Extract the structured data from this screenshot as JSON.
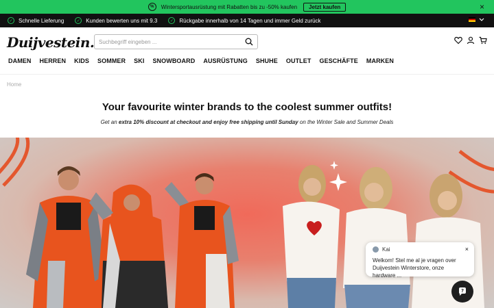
{
  "promo": {
    "text": "Wintersportausrüstung mit Rabatten bis zu -50% kaufen",
    "cta": "Jetzt kaufen",
    "icon": "percent-badge-icon",
    "close": "×"
  },
  "usp": {
    "items": [
      {
        "label": "Schnelle Lieferung",
        "icon": "check-circle-icon"
      },
      {
        "label": "Kunden bewerten uns mit 9.3",
        "icon": "check-circle-icon"
      },
      {
        "label": "Rückgabe innerhalb von 14 Tagen und immer Geld zurück",
        "icon": "check-circle-icon"
      }
    ],
    "language_flag": "de-flag-icon"
  },
  "header": {
    "logo": "Duijvestein.",
    "search_placeholder": "Suchbegriff eingeben ...",
    "icons": [
      "heart-icon",
      "user-icon",
      "cart-icon"
    ]
  },
  "nav": [
    "DAMEN",
    "HERREN",
    "KIDS",
    "SOMMER",
    "SKI",
    "SNOWBOARD",
    "AUSRÜSTUNG",
    "SHUHE",
    "OUTLET",
    "GESCHÄFTE",
    "MARKEN"
  ],
  "breadcrumb": "Home",
  "hero": {
    "headline": "Your favourite winter brands to the coolest summer outfits!",
    "sub_prefix": "Get an ",
    "sub_bold1": "extra 10% discount at checkout and enjoy free shipping until Sunday",
    "sub_suffix": " on the Winter Sale and Summer Deals"
  },
  "chat": {
    "agent": "Kai",
    "message": "Welkom! Stel me al je vragen over Duijvestein Winterstore, onze hardware ...",
    "close": "×"
  },
  "colors": {
    "promo_bg": "#22c55e",
    "usp_bg": "#111111",
    "accent": "#22c55e"
  }
}
